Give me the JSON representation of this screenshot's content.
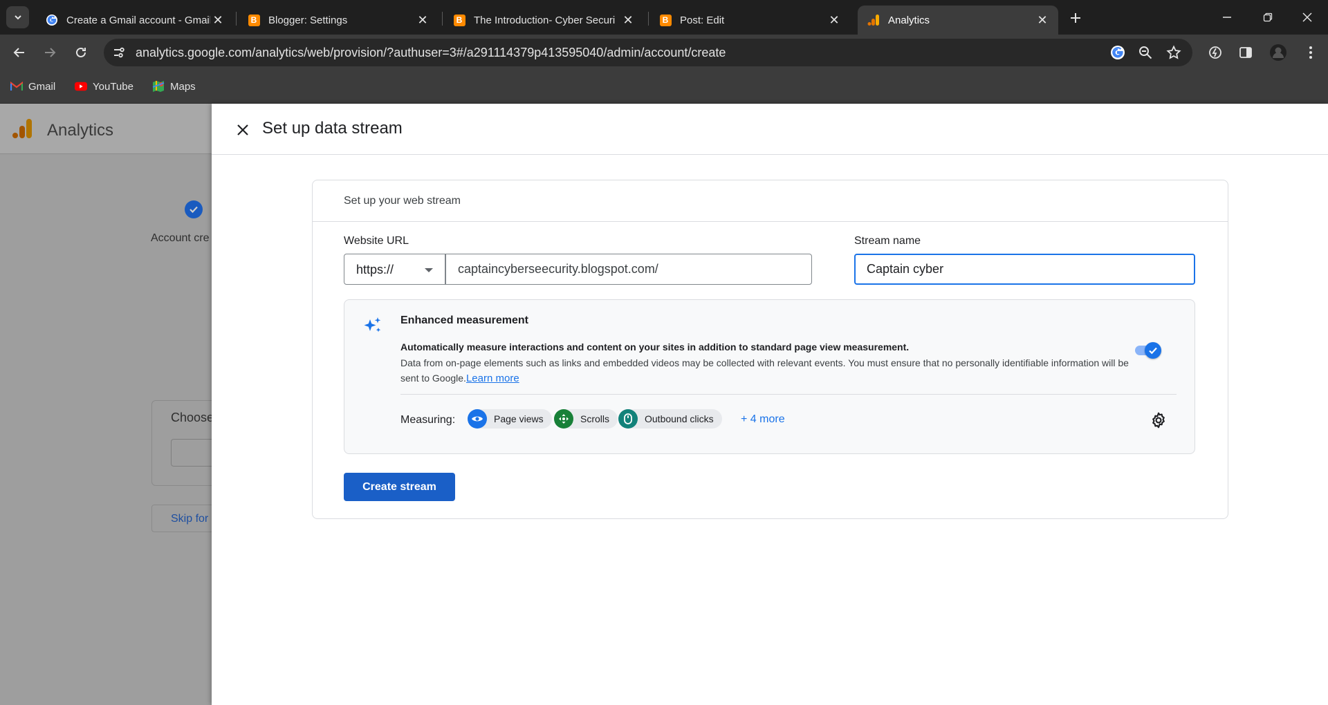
{
  "browser": {
    "tabs": [
      {
        "title": "Create a Gmail account - Gmail",
        "favicon": "google-icon"
      },
      {
        "title": "Blogger: Settings",
        "favicon": "blogger-icon"
      },
      {
        "title": "The Introduction- Cyber Securi",
        "favicon": "blogger-icon"
      },
      {
        "title": "Post: Edit",
        "favicon": "blogger-icon"
      },
      {
        "title": "Analytics",
        "favicon": "analytics-icon",
        "active": true
      }
    ],
    "url": "analytics.google.com/analytics/web/provision/?authuser=3#/a291114379p413595040/admin/account/create",
    "bookmarks": [
      {
        "label": "Gmail",
        "icon": "gmail-icon"
      },
      {
        "label": "YouTube",
        "icon": "youtube-icon"
      },
      {
        "label": "Maps",
        "icon": "maps-icon"
      }
    ]
  },
  "background_page": {
    "app_title": "Analytics",
    "step_label": "Account cre",
    "choose_label": "Choose",
    "skip_label": "Skip for"
  },
  "drawer": {
    "title": "Set up data stream",
    "card_title": "Set up your web stream",
    "website_url_label": "Website URL",
    "protocol": "https://",
    "website_url_value": "captaincyberseecurity.blogspot.com/",
    "stream_name_label": "Stream name",
    "stream_name_value": "Captain cyber",
    "enhanced": {
      "title": "Enhanced measurement",
      "description": "Automatically measure interactions and content on your sites in addition to standard page view measurement.",
      "note": "Data from on-page elements such as links and embedded videos may be collected with relevant events. You must ensure that no personally identifiable information will be sent to Google.",
      "learn_more": "Learn more",
      "enabled": true,
      "measuring_label": "Measuring:",
      "chips": [
        {
          "label": "Page views",
          "icon": "eye-icon",
          "color": "#1a73e8"
        },
        {
          "label": "Scrolls",
          "icon": "crosshair-icon",
          "color": "#188038"
        },
        {
          "label": "Outbound clicks",
          "icon": "mouse-icon",
          "color": "#12827a"
        }
      ],
      "more_label": "+ 4 more"
    },
    "create_button": "Create stream"
  },
  "colors": {
    "accent": "#1a73e8",
    "button": "#1a5fc7",
    "chrome_dark": "#1f1f1f",
    "chrome_toolbar": "#3c3c3c"
  }
}
